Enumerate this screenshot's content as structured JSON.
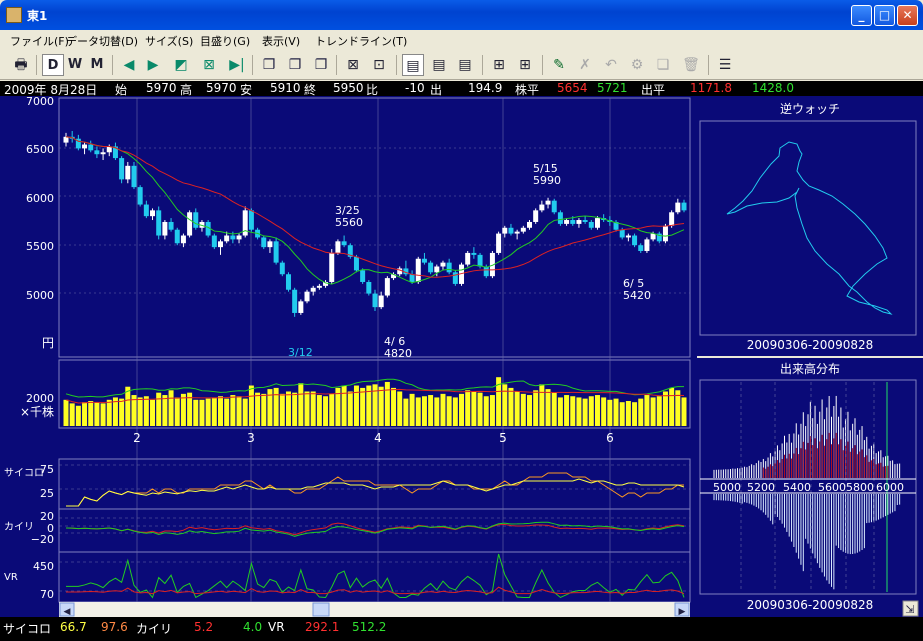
{
  "window": {
    "title": "東1"
  },
  "menu": [
    {
      "label": "ファイル(F)"
    },
    {
      "label": "データ切替(D)"
    },
    {
      "label": "サイズ(S)"
    },
    {
      "label": "目盛り(G)"
    },
    {
      "label": "表示(V)"
    },
    {
      "label": "トレンドライン(T)"
    }
  ],
  "toolbar": {
    "d_label": "D",
    "w_label": "W",
    "m_label": "M"
  },
  "info": {
    "date": "2009年 8月28日",
    "open_label": "始",
    "open": "5970",
    "high_label": "高",
    "high": "5970",
    "low_label": "安",
    "low": "5910",
    "close_label": "終",
    "close": "5950",
    "change_label": "比",
    "change": "-10",
    "volume_label": "出",
    "volume": "194.9",
    "avg_price_label": "株平",
    "avg_price_1": "5654",
    "avg_price_2": "5721",
    "avg_volume_label": "出平",
    "avg_volume_1": "1171.8",
    "avg_volume_2": "1428.0"
  },
  "colors": {
    "background": "#0a0a78",
    "up": "#ffffff",
    "down": "#22ccee",
    "ma_short": "#22cc22",
    "ma_long": "#dd2222",
    "volume": "#ffff22",
    "grid": "#6a6aa8"
  },
  "price_chart": {
    "y_ticks": [
      "7000",
      "6500",
      "6000",
      "5500",
      "5000"
    ],
    "unit": "円",
    "annotations": [
      {
        "line1": "3/25",
        "line2": "5560"
      },
      {
        "line1": "5/15",
        "line2": "5990"
      },
      {
        "line1": "6/ 5",
        "line2": "5420"
      },
      {
        "line1": "4/ 6",
        "line2": "4820"
      },
      {
        "line1": "3/12",
        "line2": ""
      }
    ]
  },
  "volume_chart": {
    "y_tick": "2000",
    "unit": "×千株",
    "month_labels": [
      "2",
      "3",
      "4",
      "5",
      "6"
    ]
  },
  "psych": {
    "label": "サイコロ",
    "ticks": [
      "75",
      "25"
    ]
  },
  "kairi": {
    "label": "カイリ",
    "ticks": [
      "20",
      "0",
      "−20"
    ]
  },
  "vr": {
    "label": "VR",
    "ticks": [
      "450",
      "70"
    ]
  },
  "reverse_watch": {
    "title": "逆ウォッチ",
    "period": "20090306-20090828"
  },
  "volume_profile": {
    "title": "出来高分布",
    "x_labels": [
      "5000",
      "5200",
      "5400",
      "5600",
      "5800",
      "6000"
    ],
    "period": "20090306-20090828"
  },
  "status": {
    "psych_label": "サイコロ",
    "psych_1": "66.7",
    "psych_2": "97.6",
    "kairi_label": "カイリ",
    "kairi_1": "5.2",
    "kairi_2": "4.0",
    "vr_label": "VR",
    "vr_1": "292.1",
    "vr_2": "512.2"
  },
  "chart_data": {
    "type": "candlestick",
    "y_range": [
      4500,
      7000
    ],
    "candles": [
      [
        6560,
        6660,
        6520,
        6620
      ],
      [
        6620,
        6680,
        6560,
        6600
      ],
      [
        6600,
        6640,
        6480,
        6500
      ],
      [
        6500,
        6560,
        6440,
        6540
      ],
      [
        6540,
        6580,
        6460,
        6480
      ],
      [
        6480,
        6520,
        6400,
        6440
      ],
      [
        6440,
        6500,
        6380,
        6460
      ],
      [
        6460,
        6540,
        6420,
        6520
      ],
      [
        6520,
        6560,
        6380,
        6400
      ],
      [
        6400,
        6420,
        6140,
        6180
      ],
      [
        6180,
        6360,
        6140,
        6320
      ],
      [
        6320,
        6360,
        6080,
        6100
      ],
      [
        6100,
        6120,
        5900,
        5920
      ],
      [
        5920,
        5960,
        5780,
        5800
      ],
      [
        5800,
        5880,
        5760,
        5860
      ],
      [
        5860,
        5900,
        5560,
        5600
      ],
      [
        5600,
        5760,
        5560,
        5740
      ],
      [
        5740,
        5780,
        5640,
        5660
      ],
      [
        5660,
        5680,
        5500,
        5520
      ],
      [
        5520,
        5620,
        5480,
        5600
      ],
      [
        5600,
        5860,
        5580,
        5840
      ],
      [
        5840,
        5880,
        5660,
        5680
      ],
      [
        5680,
        5760,
        5640,
        5740
      ],
      [
        5740,
        5760,
        5580,
        5600
      ],
      [
        5600,
        5620,
        5460,
        5480
      ],
      [
        5480,
        5560,
        5400,
        5540
      ],
      [
        5540,
        5640,
        5520,
        5600
      ],
      [
        5600,
        5640,
        5520,
        5560
      ],
      [
        5560,
        5620,
        5520,
        5600
      ],
      [
        5600,
        5900,
        5580,
        5860
      ],
      [
        5860,
        5880,
        5640,
        5660
      ],
      [
        5660,
        5680,
        5560,
        5580
      ],
      [
        5580,
        5600,
        5460,
        5480
      ],
      [
        5480,
        5560,
        5420,
        5540
      ],
      [
        5540,
        5580,
        5300,
        5320
      ],
      [
        5320,
        5340,
        5180,
        5200
      ],
      [
        5200,
        5220,
        5020,
        5040
      ],
      [
        5040,
        5060,
        4760,
        4800
      ],
      [
        4800,
        4940,
        4780,
        4920
      ],
      [
        4920,
        5040,
        4900,
        5020
      ],
      [
        5020,
        5080,
        4980,
        5060
      ],
      [
        5060,
        5100,
        5040,
        5080
      ],
      [
        5080,
        5140,
        5060,
        5120
      ],
      [
        5120,
        5460,
        5100,
        5420
      ],
      [
        5420,
        5560,
        5400,
        5540
      ],
      [
        5540,
        5600,
        5480,
        5500
      ],
      [
        5500,
        5520,
        5360,
        5380
      ],
      [
        5380,
        5400,
        5220,
        5240
      ],
      [
        5240,
        5260,
        5100,
        5120
      ],
      [
        5120,
        5140,
        4980,
        5000
      ],
      [
        5000,
        5040,
        4820,
        4860
      ],
      [
        4860,
        5020,
        4840,
        4980
      ],
      [
        4980,
        5180,
        4960,
        5160
      ],
      [
        5160,
        5220,
        5140,
        5200
      ],
      [
        5200,
        5280,
        5180,
        5260
      ],
      [
        5260,
        5340,
        5180,
        5200
      ],
      [
        5200,
        5240,
        5100,
        5120
      ],
      [
        5120,
        5380,
        5100,
        5360
      ],
      [
        5360,
        5420,
        5300,
        5320
      ],
      [
        5320,
        5340,
        5200,
        5220
      ],
      [
        5220,
        5300,
        5180,
        5280
      ],
      [
        5280,
        5340,
        5240,
        5320
      ],
      [
        5320,
        5360,
        5200,
        5220
      ],
      [
        5220,
        5240,
        5080,
        5100
      ],
      [
        5100,
        5320,
        5080,
        5300
      ],
      [
        5300,
        5440,
        5280,
        5420
      ],
      [
        5420,
        5480,
        5360,
        5400
      ],
      [
        5400,
        5420,
        5260,
        5280
      ],
      [
        5280,
        5300,
        5160,
        5180
      ],
      [
        5180,
        5440,
        5160,
        5420
      ],
      [
        5420,
        5640,
        5400,
        5620
      ],
      [
        5620,
        5700,
        5580,
        5680
      ],
      [
        5680,
        5720,
        5600,
        5620
      ],
      [
        5620,
        5660,
        5560,
        5640
      ],
      [
        5640,
        5700,
        5620,
        5680
      ],
      [
        5680,
        5760,
        5660,
        5740
      ],
      [
        5740,
        5880,
        5720,
        5860
      ],
      [
        5860,
        5960,
        5840,
        5920
      ],
      [
        5920,
        5990,
        5880,
        5960
      ],
      [
        5960,
        5980,
        5820,
        5840
      ],
      [
        5840,
        5860,
        5700,
        5720
      ],
      [
        5720,
        5780,
        5700,
        5760
      ],
      [
        5760,
        5800,
        5700,
        5720
      ],
      [
        5720,
        5780,
        5680,
        5760
      ],
      [
        5760,
        5800,
        5720,
        5740
      ],
      [
        5740,
        5760,
        5660,
        5680
      ],
      [
        5680,
        5800,
        5660,
        5780
      ],
      [
        5780,
        5820,
        5740,
        5760
      ],
      [
        5760,
        5800,
        5700,
        5740
      ],
      [
        5740,
        5760,
        5640,
        5660
      ],
      [
        5660,
        5680,
        5560,
        5580
      ],
      [
        5580,
        5620,
        5540,
        5600
      ],
      [
        5600,
        5620,
        5480,
        5500
      ],
      [
        5500,
        5520,
        5420,
        5440
      ],
      [
        5440,
        5580,
        5420,
        5560
      ],
      [
        5560,
        5640,
        5540,
        5620
      ],
      [
        5620,
        5640,
        5520,
        5540
      ],
      [
        5540,
        5720,
        5520,
        5700
      ],
      [
        5700,
        5860,
        5680,
        5840
      ],
      [
        5840,
        5980,
        5820,
        5940
      ],
      [
        5940,
        5970,
        5840,
        5860
      ]
    ],
    "volume": [
      1100,
      950,
      850,
      1000,
      1050,
      1000,
      950,
      1100,
      1200,
      1150,
      1650,
      1300,
      1200,
      1250,
      1100,
      1400,
      1300,
      1500,
      1200,
      1350,
      1400,
      1100,
      1100,
      1150,
      1200,
      1250,
      1150,
      1300,
      1250,
      1150,
      1700,
      1400,
      1350,
      1550,
      1600,
      1350,
      1450,
      1400,
      1800,
      1450,
      1450,
      1300,
      1250,
      1350,
      1600,
      1700,
      1450,
      1700,
      1600,
      1700,
      1750,
      1650,
      1850,
      1600,
      1450,
      1150,
      1350,
      1200,
      1250,
      1300,
      1200,
      1350,
      1250,
      1200,
      1350,
      1500,
      1450,
      1400,
      1250,
      1300,
      2050,
      1750,
      1600,
      1450,
      1350,
      1300,
      1500,
      1750,
      1550,
      1400,
      1200,
      1300,
      1250,
      1200,
      1150,
      1250,
      1300,
      1200,
      1100,
      1150,
      1000,
      1050,
      1000,
      1150,
      1300,
      1200,
      1250,
      1450,
      1600,
      1500,
      1200
    ]
  }
}
